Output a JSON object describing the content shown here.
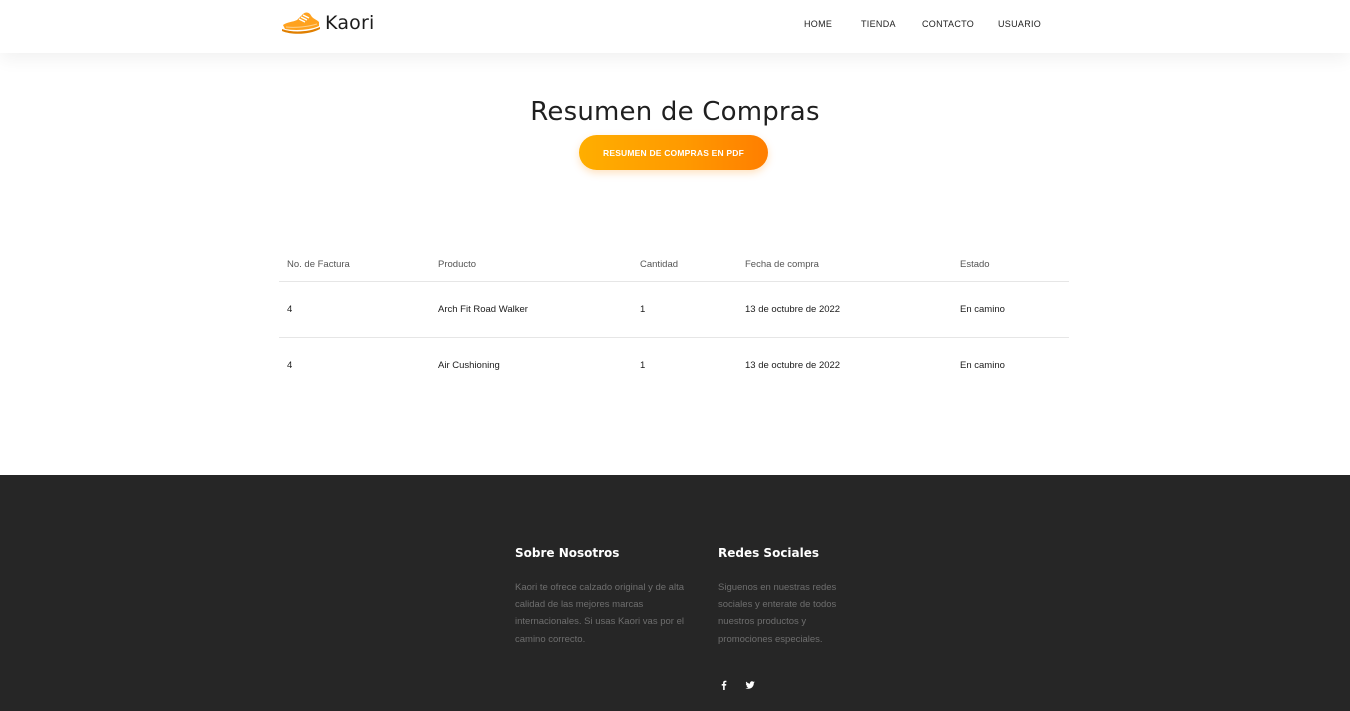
{
  "brand": {
    "name": "Kaori",
    "accent": "#ff9a00"
  },
  "nav": {
    "items": [
      "HOME",
      "TIENDA",
      "CONTACTO",
      "USUARIO"
    ]
  },
  "main": {
    "title": "Resumen de Compras",
    "pdf_button": "RESUMEN DE COMPRAS EN PDF"
  },
  "table": {
    "headers": [
      "No. de Factura",
      "Producto",
      "Cantidad",
      "Fecha de compra",
      "Estado"
    ],
    "rows": [
      [
        "4",
        "Arch Fit Road Walker",
        "1",
        "13 de octubre de 2022",
        "En camino"
      ],
      [
        "4",
        "Air Cushioning",
        "1",
        "13 de octubre de 2022",
        "En camino"
      ]
    ]
  },
  "footer": {
    "about_title": "Sobre Nosotros",
    "about_text": "Kaori te ofrece calzado original y de alta calidad de las mejores marcas internacionales. Si usas Kaori vas por el camino correcto.",
    "social_title": "Redes Sociales",
    "social_text": "Siguenos en nuestras redes sociales y enterate de todos nuestros productos y promociones especiales.",
    "social_icons": [
      "facebook-icon",
      "twitter-icon"
    ]
  }
}
